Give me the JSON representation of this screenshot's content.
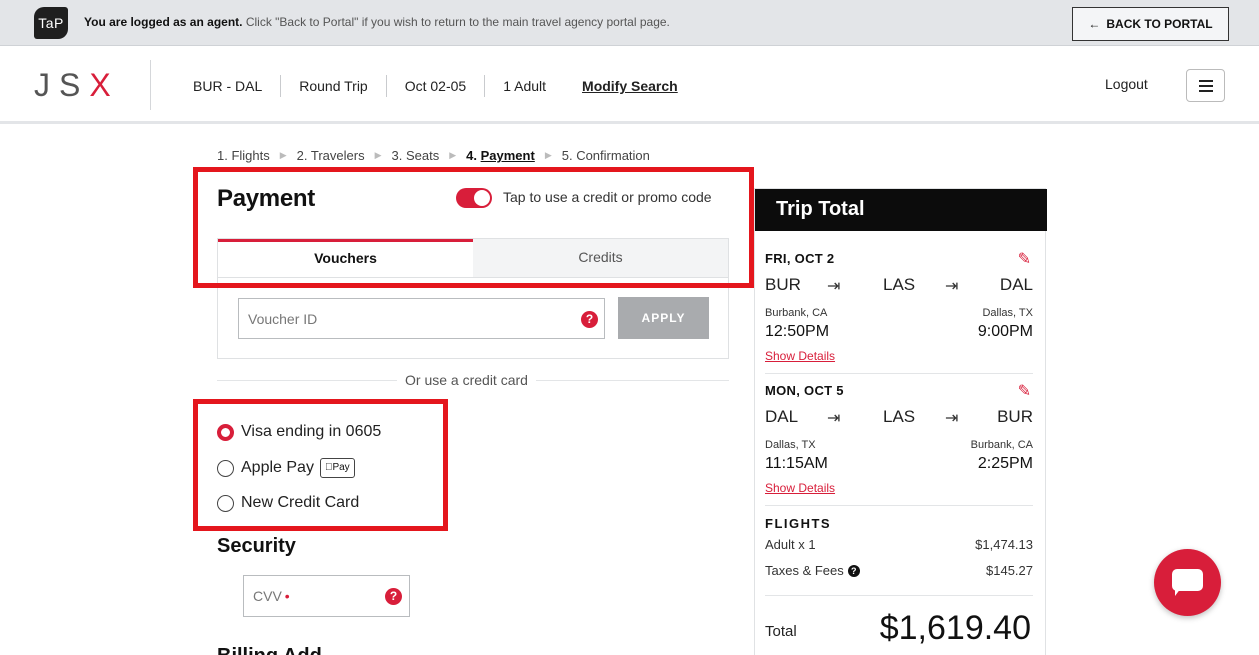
{
  "agent_bar": {
    "logo": "TaP",
    "message_bold": "You are logged as an agent.",
    "message_rest": " Click \"Back to Portal\" if you wish to return to the main travel agency portal page.",
    "back_button": "BACK TO PORTAL",
    "back_icon": "arrow-left-icon"
  },
  "header": {
    "logo_main": "JS",
    "logo_accent": "X",
    "route": "BUR - DAL",
    "trip_type": "Round Trip",
    "dates": "Oct 02-05",
    "passengers": "1 Adult",
    "modify": "Modify Search",
    "logout": "Logout",
    "menu_icon": "hamburger-menu-icon"
  },
  "steps": [
    {
      "label": "1. Flights"
    },
    {
      "label": "2. Travelers"
    },
    {
      "label": "3. Seats"
    },
    {
      "label": "Payment",
      "prefix": "4. "
    },
    {
      "label": "5. Confirmation"
    }
  ],
  "payment": {
    "title": "Payment",
    "toggle_label": "Tap to use a credit or promo code",
    "toggle_on": true,
    "tabs": [
      "Vouchers",
      "Credits"
    ],
    "voucher_placeholder": "Voucher ID",
    "help_glyph": "?",
    "apply": "APPLY",
    "or_text": "Or use a credit card",
    "options": [
      {
        "label": "Visa ending in 0605",
        "checked": true
      },
      {
        "label": "Apple Pay",
        "badge": "Pay",
        "checked": false
      },
      {
        "label": "New Credit Card",
        "checked": false
      }
    ]
  },
  "security": {
    "title": "Security",
    "cvv_placeholder": "CVV",
    "required_mark": "•"
  },
  "billing": {
    "title": "Billing Add"
  },
  "trip": {
    "title": "Trip Total",
    "legs": [
      {
        "date": "FRI, OCT 2",
        "from": "BUR",
        "via": "LAS",
        "to": "DAL",
        "from_city": "Burbank, CA",
        "to_city": "Dallas, TX",
        "depart": "12:50PM",
        "arrive": "9:00PM",
        "details": "Show Details"
      },
      {
        "date": "MON, OCT 5",
        "from": "DAL",
        "via": "LAS",
        "to": "BUR",
        "from_city": "Dallas, TX",
        "to_city": "Burbank, CA",
        "depart": "11:15AM",
        "arrive": "2:25PM",
        "details": "Show Details"
      }
    ],
    "flights_heading": "FLIGHTS",
    "adult_label": "Adult x 1",
    "adult_amount": "$1,474.13",
    "taxes_label": "Taxes & Fees",
    "taxes_amount": "$145.27",
    "total_label": "Total",
    "total_amount": "$1,619.40"
  },
  "colors": {
    "accent": "#d81e3a",
    "highlight": "#e4161d"
  }
}
